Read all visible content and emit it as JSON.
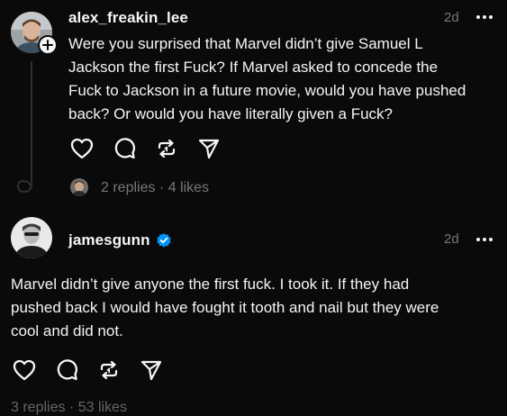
{
  "post1": {
    "username": "alex_freakin_lee",
    "time": "2d",
    "lines": [
      "Were you surprised that Marvel didn’t give Samuel L",
      "Jackson the first Fuck?  If Marvel asked to concede the",
      "Fuck to Jackson in a future movie, would you have pushed",
      "back?  Or would you have literally given a Fuck?"
    ],
    "replies_text": "2 replies · 4 likes"
  },
  "post2": {
    "username": "jamesgunn",
    "time": "2d",
    "lines": [
      "Marvel didn’t give anyone the first fuck. I took it. If they had",
      "pushed back I would have fought it tooth and nail but they were",
      "cool and did not."
    ],
    "replies_text": "3 replies · 53 likes"
  },
  "icons": {
    "like": "heart-icon",
    "comment": "comment-icon",
    "repost": "repost-icon",
    "share": "share-icon",
    "more": "more-icon",
    "follow": "plus-icon",
    "verified": "verified-badge-icon"
  },
  "colors": {
    "background": "#0a0a0a",
    "text": "#f3f5f7",
    "secondary": "#777777",
    "verified": "#0095f6",
    "thread_line": "#2f2f2f"
  }
}
